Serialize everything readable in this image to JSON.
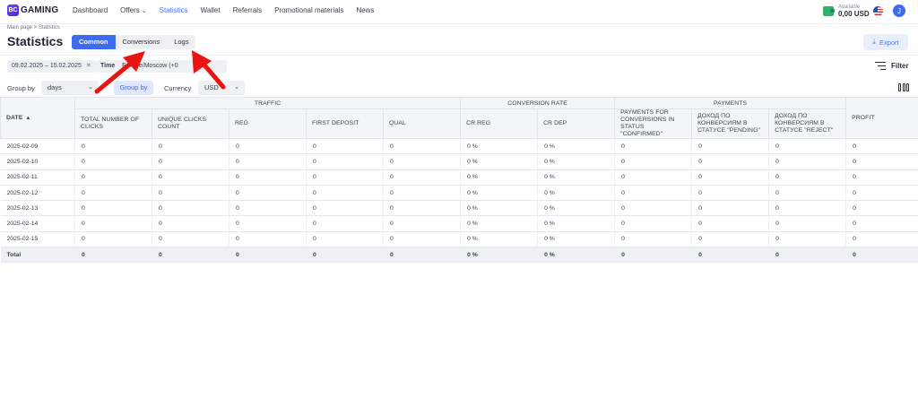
{
  "brand": {
    "logo_mark": "BC",
    "logo_text": "GAMING"
  },
  "nav": {
    "items": [
      {
        "label": "Dashboard",
        "active": false,
        "dropdown": false
      },
      {
        "label": "Offers",
        "active": false,
        "dropdown": true
      },
      {
        "label": "Statistics",
        "active": true,
        "dropdown": false
      },
      {
        "label": "Wallet",
        "active": false,
        "dropdown": false
      },
      {
        "label": "Referrals",
        "active": false,
        "dropdown": false
      },
      {
        "label": "Promotional materials",
        "active": false,
        "dropdown": false
      },
      {
        "label": "News",
        "active": false,
        "dropdown": false
      }
    ]
  },
  "header": {
    "balance_label": "Available",
    "balance_value": "0,00 USD",
    "avatar_initial": "J"
  },
  "page": {
    "breadcrumb": "Main page > Statistics",
    "title": "Statistics",
    "tabs": [
      {
        "label": "Common",
        "active": true
      },
      {
        "label": "Conversions",
        "active": false
      },
      {
        "label": "Logs",
        "active": false
      }
    ],
    "export_label": "Export"
  },
  "filters": {
    "date_chip": "09.02.2025 – 15.02.2025",
    "timezone_chip_prefix": "Time",
    "timezone_chip_value": "Europe/Moscow (+0",
    "filter_label": "Filter"
  },
  "controls": {
    "group_by_label": "Group by",
    "group_by_value": "days",
    "group_by_button": "Group by",
    "currency_label": "Currency",
    "currency_value": "USD"
  },
  "table": {
    "groups": {
      "traffic": "Traffic",
      "conversion_rate": "Conversion rate",
      "payments": "Payments"
    },
    "columns": {
      "date": "Date",
      "total_clicks": "Total number of clicks",
      "unique_clicks": "Unique clicks count",
      "reg": "Reg",
      "first_deposit": "First deposit",
      "qual": "Qual",
      "cr_reg": "CR REG",
      "cr_dep": "CR DEP",
      "pay_confirmed": "Payments for conversions in status \"Confirmed\"",
      "pay_pending": "Доход по конверсиям в статусе \"Pending\"",
      "pay_reject": "Доход по конверсиям в статусе \"Reject\"",
      "profit": "Profit"
    },
    "rows": [
      [
        "2025-02-09",
        "0",
        "0",
        "0",
        "0",
        "0",
        "0 %",
        "0 %",
        "0",
        "0",
        "0",
        "0"
      ],
      [
        "2025-02-10",
        "0",
        "0",
        "0",
        "0",
        "0",
        "0 %",
        "0 %",
        "0",
        "0",
        "0",
        "0"
      ],
      [
        "2025-02-11",
        "0",
        "0",
        "0",
        "0",
        "0",
        "0 %",
        "0 %",
        "0",
        "0",
        "0",
        "0"
      ],
      [
        "2025-02-12",
        "0",
        "0",
        "0",
        "0",
        "0",
        "0 %",
        "0 %",
        "0",
        "0",
        "0",
        "0"
      ],
      [
        "2025-02-13",
        "0",
        "0",
        "0",
        "0",
        "0",
        "0 %",
        "0 %",
        "0",
        "0",
        "0",
        "0"
      ],
      [
        "2025-02-14",
        "0",
        "0",
        "0",
        "0",
        "0",
        "0 %",
        "0 %",
        "0",
        "0",
        "0",
        "0"
      ],
      [
        "2025-02-15",
        "0",
        "0",
        "0",
        "0",
        "0",
        "0 %",
        "0 %",
        "0",
        "0",
        "0",
        "0"
      ]
    ],
    "total": [
      "Total",
      "0",
      "0",
      "0",
      "0",
      "0",
      "0 %",
      "0 %",
      "0",
      "0",
      "0",
      "0"
    ]
  },
  "colors": {
    "accent": "#3d6cf0",
    "arrow": "#e8140f",
    "wallet": "#2fb36b"
  }
}
